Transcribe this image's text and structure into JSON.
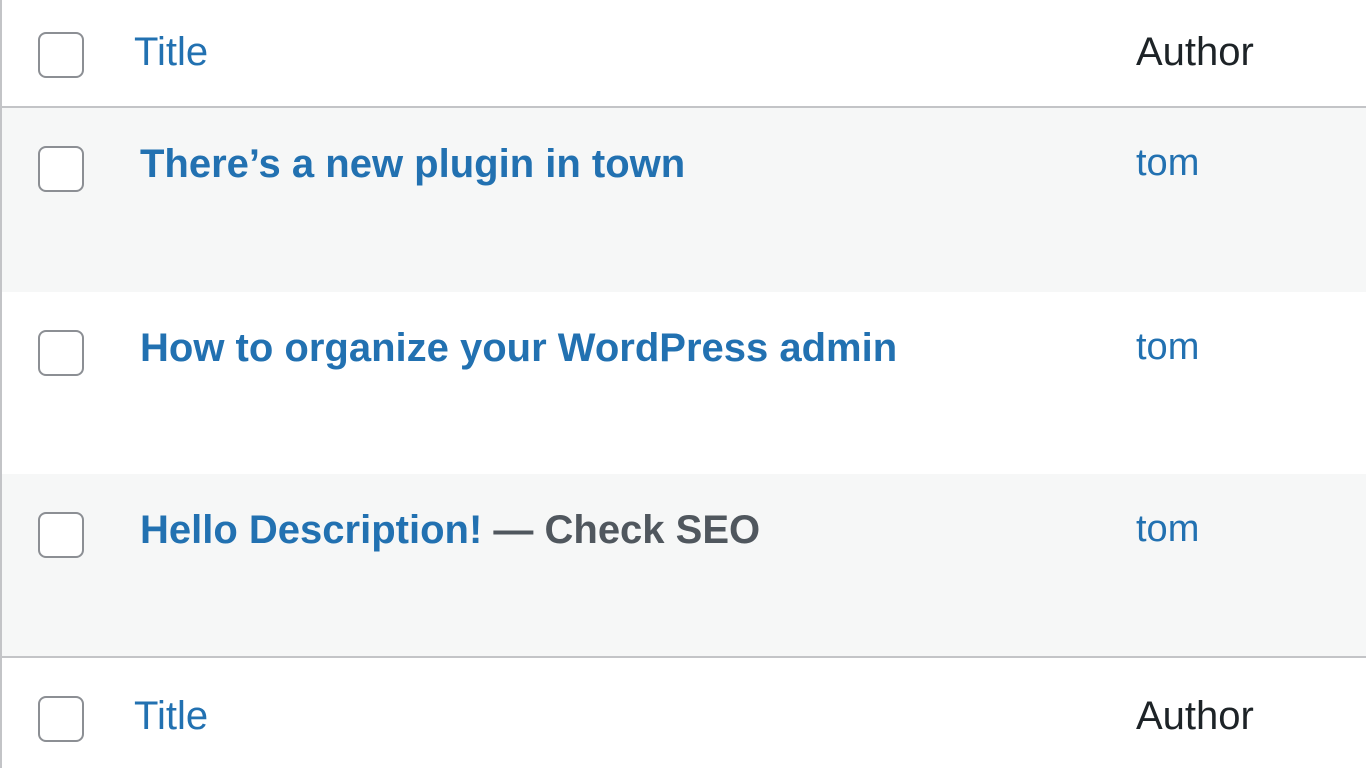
{
  "header": {
    "title_label": "Title",
    "author_label": "Author"
  },
  "rows": [
    {
      "title": "There’s a new plugin in town",
      "state": "",
      "author": "tom"
    },
    {
      "title": "How to organize your WordPress admin",
      "state": "",
      "author": "tom"
    },
    {
      "title": "Hello Description!",
      "state": " — Check SEO",
      "author": "tom"
    }
  ],
  "footer": {
    "title_label": "Title",
    "author_label": "Author"
  },
  "colors": {
    "link": "#2271b1",
    "text": "#1d2327",
    "alt_row": "#f6f7f7",
    "border": "#c3c4c7"
  }
}
